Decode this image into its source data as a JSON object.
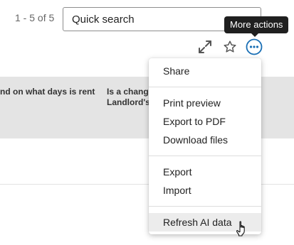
{
  "pagination": {
    "range_text": "1 - 5 of 5"
  },
  "search": {
    "placeholder": "Quick search"
  },
  "toolbar": {
    "expand_icon": "expand-icon",
    "star_icon": "star-icon",
    "more_icon": "more-horizontal-icon",
    "more_tooltip": "More actions",
    "accent_color": "#1a6fb5"
  },
  "table": {
    "columns": [
      "nd on what days is rent",
      "Is a chang\nLandlord's"
    ]
  },
  "menu": {
    "items": [
      {
        "label": "Share"
      },
      {
        "label": "Print preview"
      },
      {
        "label": "Export to PDF"
      },
      {
        "label": "Download files"
      },
      {
        "label": "Export"
      },
      {
        "label": "Import"
      },
      {
        "label": "Refresh AI data"
      }
    ],
    "hover_color": "#ececec"
  }
}
